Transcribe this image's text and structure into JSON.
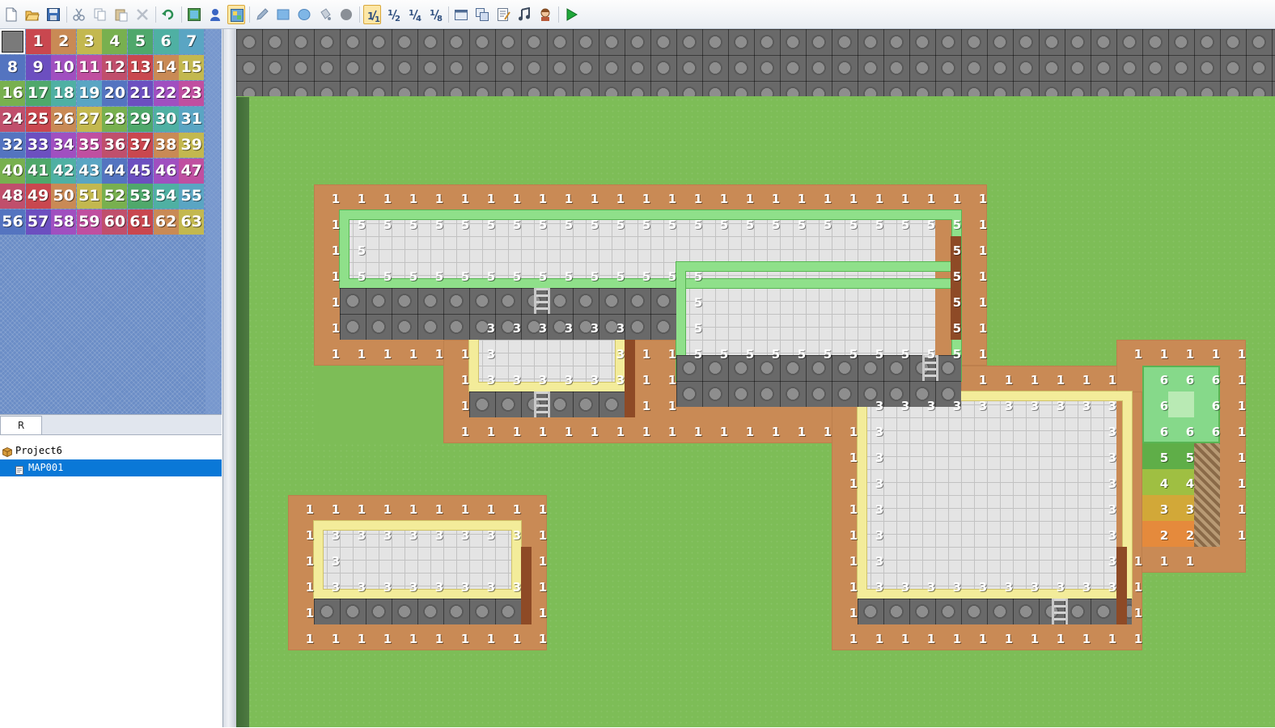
{
  "toolbar": {
    "groups": [
      {
        "icons": [
          "new-project-icon",
          "open-project-icon",
          "save-project-icon"
        ]
      },
      {
        "icons": [
          "cut-icon",
          "copy-icon",
          "paste-icon",
          "delete-icon"
        ]
      },
      {
        "icons": [
          "undo-icon"
        ]
      },
      {
        "icons": [
          "map-layer-icon",
          "event-layer-icon",
          "region-layer-icon"
        ]
      },
      {
        "icons": [
          "pencil-icon",
          "rectangle-icon",
          "ellipse-icon",
          "flood-fill-icon",
          "shadow-pen-icon"
        ]
      },
      {
        "icons": [
          "zoom-1-1-icon",
          "zoom-1-2-icon",
          "zoom-1-4-icon",
          "zoom-1-8-icon"
        ]
      },
      {
        "icons": [
          "database-icon",
          "resource-manager-icon",
          "script-editor-icon",
          "sound-test-icon",
          "character-generator-icon"
        ]
      },
      {
        "icons": [
          "playtest-icon"
        ]
      }
    ],
    "active": [
      "region-layer-icon",
      "zoom-1-1-icon"
    ],
    "colors": {
      "play": "#1fa83a",
      "active_bg": "#fde7a6"
    }
  },
  "palette": {
    "tab": "R",
    "region_ids": [
      "",
      "1",
      "2",
      "3",
      "4",
      "5",
      "6",
      "7",
      "8",
      "9",
      "10",
      "11",
      "12",
      "13",
      "14",
      "15",
      "16",
      "17",
      "18",
      "19",
      "20",
      "21",
      "22",
      "23",
      "24",
      "25",
      "26",
      "27",
      "28",
      "29",
      "30",
      "31",
      "32",
      "33",
      "34",
      "35",
      "36",
      "37",
      "38",
      "39",
      "40",
      "41",
      "42",
      "43",
      "44",
      "45",
      "46",
      "47",
      "48",
      "49",
      "50",
      "51",
      "52",
      "53",
      "54",
      "55",
      "56",
      "57",
      "58",
      "59",
      "60",
      "61",
      "62",
      "63"
    ],
    "region_colors": [
      "#7a7a7a",
      "#c9474f",
      "#c98a55",
      "#c3b84f",
      "#78b04f",
      "#4fa86b",
      "#4fb0a3",
      "#5aa5c3",
      "#5474c0",
      "#6c4fc0",
      "#a04fc0",
      "#c04fa0",
      "#c04f6c",
      "#c9474f",
      "#c98a55",
      "#c3b84f",
      "#78b04f",
      "#4fa86b",
      "#4fb0a3",
      "#5aa5c3",
      "#5474c0",
      "#6c4fc0",
      "#a04fc0",
      "#c04fa0",
      "#c04f6c",
      "#c9474f",
      "#c98a55",
      "#c3b84f",
      "#78b04f",
      "#4fa86b",
      "#4fb0a3",
      "#5aa5c3",
      "#5474c0",
      "#6c4fc0",
      "#a04fc0",
      "#c04fa0",
      "#c04f6c",
      "#c9474f",
      "#c98a55",
      "#c3b84f",
      "#78b04f",
      "#4fa86b",
      "#4fb0a3",
      "#5aa5c3",
      "#5474c0",
      "#6c4fc0",
      "#a04fc0",
      "#c04fa0",
      "#c04f6c",
      "#c9474f",
      "#c98a55",
      "#c3b84f",
      "#78b04f",
      "#4fa86b",
      "#4fb0a3",
      "#5aa5c3",
      "#5474c0",
      "#6c4fc0",
      "#a04fc0",
      "#c04fa0",
      "#c04f6c",
      "#c9474f",
      "#c98a55",
      "#c3b84f"
    ],
    "selected": ""
  },
  "tree": {
    "project": "Project6",
    "maps": [
      "MAP001"
    ],
    "selected": "MAP001"
  },
  "map": {
    "region_colors": {
      "1": "#c98a55",
      "2": "#e58a3c",
      "3": "#f3ec9a",
      "4": "#a7c85a",
      "5": "#8fe08a",
      "6": "#86d98a"
    },
    "tile_rows": [
      {
        "row": 6,
        "cols": [
          {
            "from": 3,
            "to": 28,
            "v": "1"
          }
        ]
      },
      {
        "row": 7,
        "cols": [
          {
            "from": 3,
            "to": 3,
            "v": "1"
          },
          {
            "from": 4,
            "to": 27,
            "v": "5"
          },
          {
            "from": 28,
            "to": 28,
            "v": "1"
          }
        ]
      },
      {
        "row": 8,
        "cols": [
          {
            "from": 3,
            "to": 3,
            "v": "1"
          },
          {
            "from": 4,
            "to": 4,
            "v": "5"
          },
          {
            "from": 27,
            "to": 27,
            "v": "5"
          },
          {
            "from": 28,
            "to": 28,
            "v": "1"
          }
        ]
      },
      {
        "row": 9,
        "cols": [
          {
            "from": 3,
            "to": 3,
            "v": "1"
          },
          {
            "from": 4,
            "to": 17,
            "v": "5"
          },
          {
            "from": 27,
            "to": 27,
            "v": "5"
          },
          {
            "from": 28,
            "to": 28,
            "v": "1"
          }
        ]
      },
      {
        "row": 10,
        "cols": [
          {
            "from": 3,
            "to": 3,
            "v": "1"
          },
          {
            "from": 17,
            "to": 17,
            "v": "5"
          },
          {
            "from": 27,
            "to": 27,
            "v": "5"
          },
          {
            "from": 28,
            "to": 28,
            "v": "1"
          }
        ]
      },
      {
        "row": 11,
        "cols": [
          {
            "from": 3,
            "to": 3,
            "v": "1"
          },
          {
            "from": 9,
            "to": 14,
            "v": "3"
          },
          {
            "from": 17,
            "to": 17,
            "v": "5"
          },
          {
            "from": 27,
            "to": 27,
            "v": "5"
          },
          {
            "from": 28,
            "to": 28,
            "v": "1"
          }
        ]
      },
      {
        "row": 12,
        "cols": [
          {
            "from": 3,
            "to": 8,
            "v": "1"
          },
          {
            "from": 9,
            "to": 9,
            "v": "3"
          },
          {
            "from": 14,
            "to": 14,
            "v": "3"
          },
          {
            "from": 15,
            "to": 16,
            "v": "1"
          },
          {
            "from": 17,
            "to": 27,
            "v": "5"
          },
          {
            "from": 28,
            "to": 28,
            "v": "1"
          },
          {
            "from": 34,
            "to": 38,
            "v": "1"
          }
        ]
      },
      {
        "row": 13,
        "cols": [
          {
            "from": 8,
            "to": 8,
            "v": "1"
          },
          {
            "from": 9,
            "to": 14,
            "v": "3"
          },
          {
            "from": 15,
            "to": 16,
            "v": "1"
          },
          {
            "from": 28,
            "to": 33,
            "v": "1"
          },
          {
            "from": 35,
            "to": 37,
            "v": "6"
          },
          {
            "from": 38,
            "to": 38,
            "v": "1"
          }
        ]
      },
      {
        "row": 14,
        "cols": [
          {
            "from": 8,
            "to": 8,
            "v": "1"
          },
          {
            "from": 15,
            "to": 16,
            "v": "1"
          },
          {
            "from": 24,
            "to": 33,
            "v": "3"
          },
          {
            "from": 35,
            "to": 35,
            "v": "6"
          },
          {
            "from": 37,
            "to": 37,
            "v": "6"
          },
          {
            "from": 38,
            "to": 38,
            "v": "1"
          }
        ]
      },
      {
        "row": 15,
        "cols": [
          {
            "from": 8,
            "to": 23,
            "v": "1"
          },
          {
            "from": 24,
            "to": 24,
            "v": "3"
          },
          {
            "from": 33,
            "to": 33,
            "v": "3"
          },
          {
            "from": 35,
            "to": 37,
            "v": "6"
          },
          {
            "from": 38,
            "to": 38,
            "v": "1"
          }
        ]
      },
      {
        "row": 16,
        "cols": [
          {
            "from": 23,
            "to": 23,
            "v": "1"
          },
          {
            "from": 24,
            "to": 24,
            "v": "3"
          },
          {
            "from": 33,
            "to": 33,
            "v": "3"
          },
          {
            "from": 35,
            "to": 36,
            "v": "5"
          },
          {
            "from": 38,
            "to": 38,
            "v": "1"
          }
        ]
      },
      {
        "row": 17,
        "cols": [
          {
            "from": 23,
            "to": 23,
            "v": "1"
          },
          {
            "from": 24,
            "to": 24,
            "v": "3"
          },
          {
            "from": 33,
            "to": 33,
            "v": "3"
          },
          {
            "from": 35,
            "to": 36,
            "v": "4"
          },
          {
            "from": 38,
            "to": 38,
            "v": "1"
          }
        ]
      },
      {
        "row": 18,
        "cols": [
          {
            "from": 2,
            "to": 11,
            "v": "1"
          },
          {
            "from": 23,
            "to": 23,
            "v": "1"
          },
          {
            "from": 24,
            "to": 24,
            "v": "3"
          },
          {
            "from": 33,
            "to": 33,
            "v": "3"
          },
          {
            "from": 35,
            "to": 36,
            "v": "3"
          },
          {
            "from": 38,
            "to": 38,
            "v": "1"
          }
        ]
      },
      {
        "row": 19,
        "cols": [
          {
            "from": 2,
            "to": 2,
            "v": "1"
          },
          {
            "from": 3,
            "to": 10,
            "v": "3"
          },
          {
            "from": 11,
            "to": 11,
            "v": "1"
          },
          {
            "from": 23,
            "to": 23,
            "v": "1"
          },
          {
            "from": 24,
            "to": 24,
            "v": "3"
          },
          {
            "from": 33,
            "to": 33,
            "v": "3"
          },
          {
            "from": 35,
            "to": 36,
            "v": "2"
          },
          {
            "from": 38,
            "to": 38,
            "v": "1"
          }
        ]
      },
      {
        "row": 20,
        "cols": [
          {
            "from": 2,
            "to": 2,
            "v": "1"
          },
          {
            "from": 3,
            "to": 3,
            "v": "3"
          },
          {
            "from": 11,
            "to": 11,
            "v": "1"
          },
          {
            "from": 23,
            "to": 23,
            "v": "1"
          },
          {
            "from": 24,
            "to": 24,
            "v": "3"
          },
          {
            "from": 33,
            "to": 33,
            "v": "3"
          },
          {
            "from": 34,
            "to": 36,
            "v": "1"
          }
        ]
      },
      {
        "row": 21,
        "cols": [
          {
            "from": 2,
            "to": 2,
            "v": "1"
          },
          {
            "from": 3,
            "to": 10,
            "v": "3"
          },
          {
            "from": 11,
            "to": 11,
            "v": "1"
          },
          {
            "from": 23,
            "to": 23,
            "v": "1"
          },
          {
            "from": 24,
            "to": 33,
            "v": "3"
          },
          {
            "from": 34,
            "to": 34,
            "v": "1"
          }
        ]
      },
      {
        "row": 22,
        "cols": [
          {
            "from": 2,
            "to": 2,
            "v": "1"
          },
          {
            "from": 11,
            "to": 11,
            "v": "1"
          },
          {
            "from": 23,
            "to": 23,
            "v": "1"
          },
          {
            "from": 34,
            "to": 34,
            "v": "1"
          }
        ]
      },
      {
        "row": 23,
        "cols": [
          {
            "from": 2,
            "to": 11,
            "v": "1"
          },
          {
            "from": 23,
            "to": 34,
            "v": "1"
          }
        ]
      }
    ]
  }
}
